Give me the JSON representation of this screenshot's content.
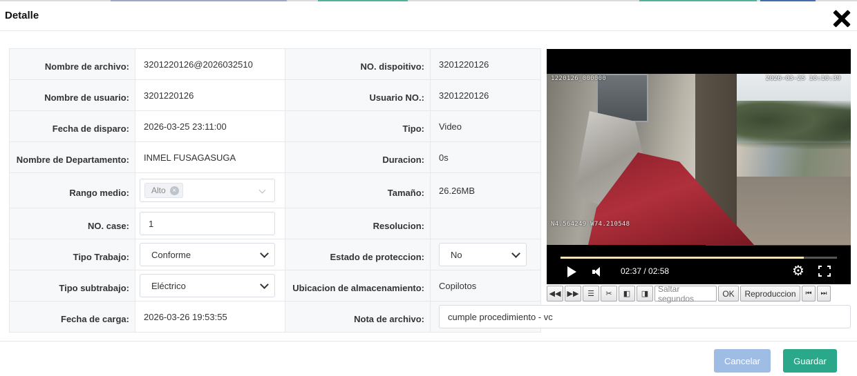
{
  "dialog": {
    "title": "Detalle"
  },
  "fields": {
    "nombre_archivo": {
      "label": "Nombre de archivo:",
      "value": "3201220126@2026032510"
    },
    "no_dispositivo": {
      "label": "NO. dispoitivo:",
      "value": "3201220126"
    },
    "nombre_usuario": {
      "label": "Nombre de usuario:",
      "value": "3201220126"
    },
    "usuario_no": {
      "label": "Usuario NO.:",
      "value": "3201220126"
    },
    "fecha_disparo": {
      "label": "Fecha de disparo:",
      "value": "2026-03-25 23:11:00"
    },
    "tipo": {
      "label": "Tipo:",
      "value": "Video"
    },
    "departamento": {
      "label": "Nombre de Departamento:",
      "value": "INMEL FUSAGASUGA"
    },
    "duracion": {
      "label": "Duracion:",
      "value": "0s"
    },
    "rango_medio": {
      "label": "Rango medio:",
      "tag": "Alto"
    },
    "tamano": {
      "label": "Tamaño:",
      "value": "26.26MB"
    },
    "no_case": {
      "label": "NO. case:",
      "value": "1"
    },
    "resolucion": {
      "label": "Resolucion:",
      "value": ""
    },
    "tipo_trabajo": {
      "label": "Tipo Trabajo:",
      "value": "Conforme"
    },
    "estado_proteccion": {
      "label": "Estado de proteccion:",
      "value": "No"
    },
    "tipo_subtrabajo": {
      "label": "Tipo subtrabajo:",
      "value": "Eléctrico"
    },
    "ubicacion": {
      "label": "Ubicacion de almacenamiento:",
      "value": "Copilotos"
    },
    "fecha_carga": {
      "label": "Fecha de carga:",
      "value": "2026-03-26 19:53:55"
    },
    "nota_archivo": {
      "label": "Nota de archivo:",
      "value": "cumple procedimiento - vc"
    }
  },
  "video": {
    "osd_left": "1220126_000000",
    "osd_right": "2026-03-25 10:10:39",
    "osd_gps": "N4.564249 W74.210548",
    "time_display": "02:37 / 02:58",
    "progress": 0.88,
    "buffered": 0.96
  },
  "toolbar": {
    "seek_placeholder": "Saltar segundos",
    "ok_label": "OK",
    "playback_label": "Reproduccion"
  },
  "footer": {
    "cancel_label": "Cancelar",
    "save_label": "Guardar"
  },
  "colors": {
    "save": "#2aa889",
    "cancel": "#9fbde4"
  }
}
